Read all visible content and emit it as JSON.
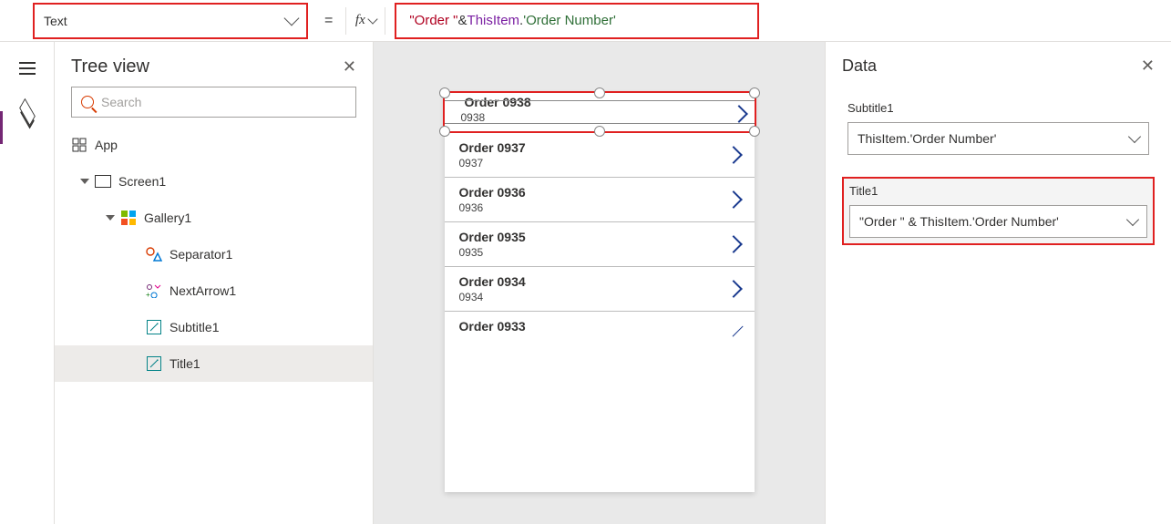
{
  "formula_bar": {
    "property": "Text",
    "fx_label": "fx",
    "formula_str": "\"Order \"",
    "formula_amp": " & ",
    "formula_kw": "ThisItem",
    "formula_dot": ".",
    "formula_field": "'Order Number'"
  },
  "tree": {
    "title": "Tree view",
    "search_placeholder": "Search",
    "items": [
      {
        "label": "App"
      },
      {
        "label": "Screen1"
      },
      {
        "label": "Gallery1"
      },
      {
        "label": "Separator1"
      },
      {
        "label": "NextArrow1"
      },
      {
        "label": "Subtitle1"
      },
      {
        "label": "Title1"
      }
    ]
  },
  "gallery": {
    "rows": [
      {
        "title": "Order 0938",
        "sub": "0938"
      },
      {
        "title": "Order 0937",
        "sub": "0937"
      },
      {
        "title": "Order 0936",
        "sub": "0936"
      },
      {
        "title": "Order 0935",
        "sub": "0935"
      },
      {
        "title": "Order 0934",
        "sub": "0934"
      },
      {
        "title": "Order 0933",
        "sub": ""
      }
    ]
  },
  "data_panel": {
    "title": "Data",
    "subtitle_label": "Subtitle1",
    "subtitle_value": "ThisItem.'Order Number'",
    "title_label": "Title1",
    "title_value": "\"Order \" & ThisItem.'Order Number'"
  }
}
